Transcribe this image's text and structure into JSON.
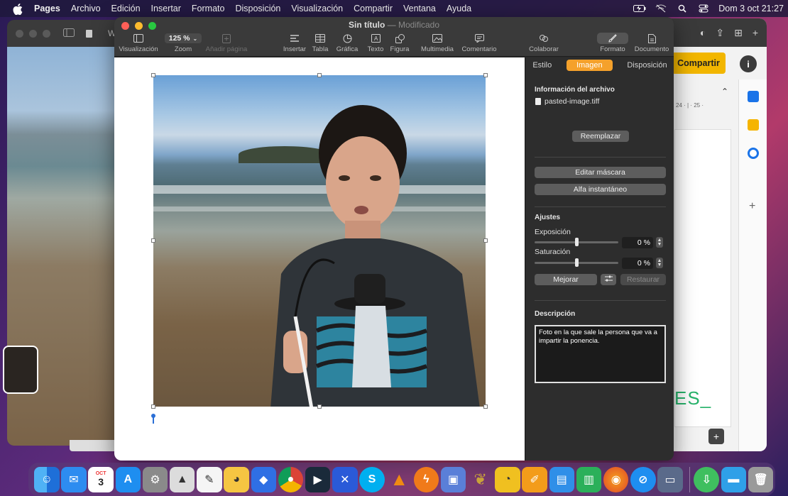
{
  "menubar": {
    "app": "Pages",
    "items": [
      "Archivo",
      "Edición",
      "Insertar",
      "Formato",
      "Disposición",
      "Visualización",
      "Compartir",
      "Ventana",
      "Ayuda"
    ],
    "clock": "Dom 3 oct  21:27"
  },
  "bg_left_window": {
    "title": "Wha"
  },
  "bg_right_window": {
    "share_label": "Compartir",
    "info_label": "i",
    "ruler": "24 · | · 25 ·",
    "doc_text": "ES_"
  },
  "window": {
    "title": "Sin título",
    "separator": " — ",
    "status": "Modificado"
  },
  "toolbar": {
    "view_label": "Visualización",
    "zoom_value": "125 %",
    "zoom_label": "Zoom",
    "add_page_label": "Añadir página",
    "insert_label": "Insertar",
    "table_label": "Tabla",
    "chart_label": "Gráfica",
    "text_label": "Texto",
    "shape_label": "Figura",
    "media_label": "Multimedia",
    "comment_label": "Comentario",
    "collaborate_label": "Colaborar",
    "format_label": "Formato",
    "document_label": "Documento"
  },
  "inspector": {
    "tabs": [
      "Estilo",
      "Imagen",
      "Disposición"
    ],
    "active_tab": "Imagen",
    "file_info_title": "Información del archivo",
    "file_name": "pasted-image.tiff",
    "replace_button": "Reemplazar",
    "edit_mask_button": "Editar máscara",
    "instant_alpha_button": "Alfa instantáneo",
    "adjustments_title": "Ajustes",
    "exposure_label": "Exposición",
    "exposure_value": "0 %",
    "exposure_level": 0.5,
    "saturation_label": "Saturación",
    "saturation_value": "0 %",
    "saturation_level": 0.5,
    "enhance_button": "Mejorar",
    "restore_button": "Restaurar",
    "description_title": "Descripción",
    "description_text": "Foto en la que sale la persona que va a impartir la ponencia."
  },
  "dock": {
    "calendar_month": "OCT",
    "calendar_day": "3",
    "apps": [
      "finder",
      "mail",
      "calendar",
      "app-store",
      "system-preferences",
      "preview",
      "textedit",
      "pages-duck",
      "dropbox",
      "chrome",
      "video",
      "x-app",
      "skype",
      "vlc",
      "flash",
      "facetime",
      "duck-app",
      "rss",
      "pencil",
      "keynote-blue",
      "numbers",
      "firefox",
      "safari",
      "screen-app",
      "downloads-green",
      "folder",
      "trash"
    ]
  },
  "colors": {
    "accent_orange": "#f5a12b",
    "share_yellow": "#f2b600",
    "selection_blue": "#2b6fd6"
  }
}
